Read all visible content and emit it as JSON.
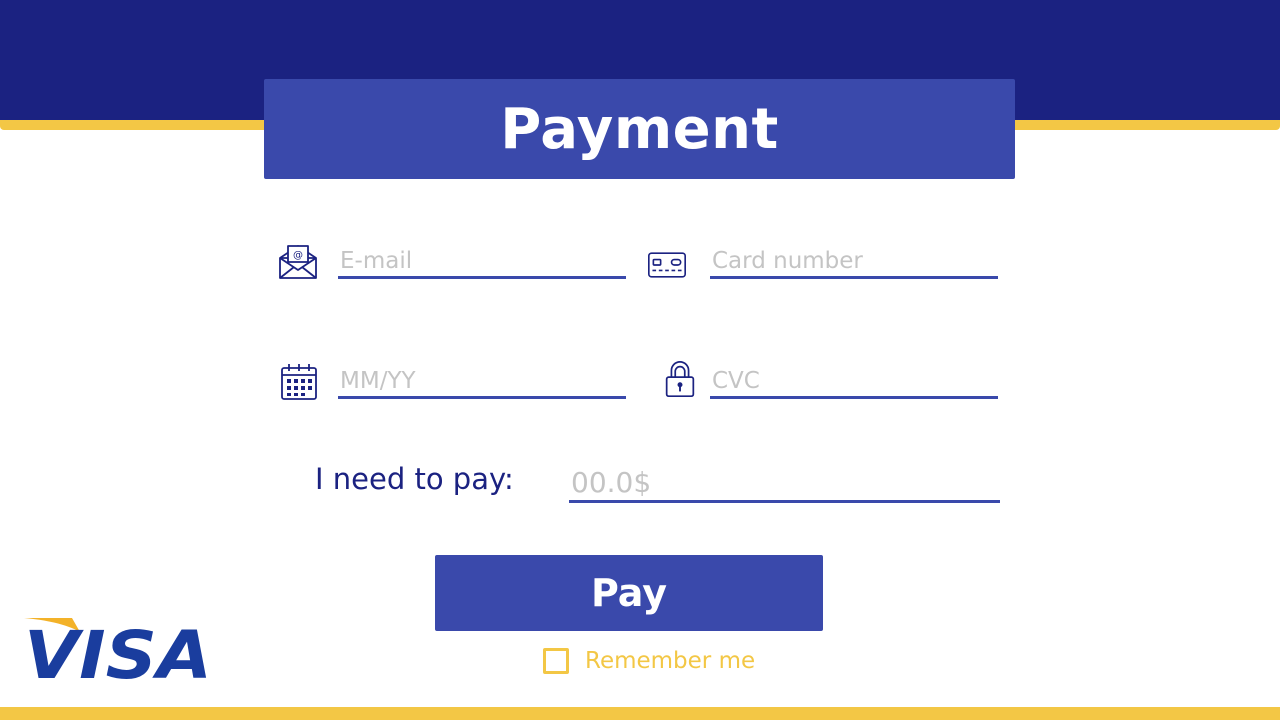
{
  "header": {
    "title": "Payment"
  },
  "form": {
    "email": {
      "placeholder": "E-mail",
      "value": "",
      "icon": "envelope-icon"
    },
    "card_number": {
      "placeholder": "Card number",
      "value": "",
      "icon": "credit-card-icon"
    },
    "expiry": {
      "placeholder": "MM/YY",
      "value": "",
      "icon": "calendar-icon"
    },
    "cvc": {
      "placeholder": "CVC",
      "value": "",
      "icon": "padlock-icon"
    },
    "amount": {
      "label": "I need to pay:",
      "placeholder": "00.0$",
      "value": ""
    },
    "pay_button_label": "Pay",
    "remember_label": "Remember me",
    "remember_checked": false
  },
  "brand": {
    "logo_text": "VISA"
  },
  "colors": {
    "navy": "#1b2281",
    "accent_blue": "#3a49ab",
    "gold": "#f3c745",
    "placeholder_gray": "#c4c4c4"
  }
}
